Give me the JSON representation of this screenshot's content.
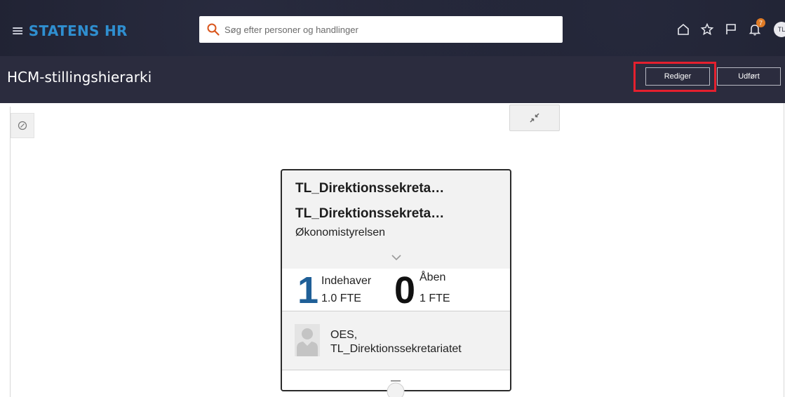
{
  "header": {
    "menu_icon": "hamburger-icon",
    "brand": "STATENS HR",
    "brand_color": "#2f8fd0",
    "search": {
      "placeholder": "Søg efter personer og handlinger",
      "value": ""
    },
    "icons": [
      "home-icon",
      "star-icon",
      "flag-icon",
      "bell-icon"
    ],
    "notification_count": "7",
    "user_initials": "TL"
  },
  "titlebar": {
    "title": "HCM-stillingshierarki",
    "edit_label": "Rediger",
    "done_label": "Udført",
    "highlight_color": "#e5202e"
  },
  "toolbar": {
    "side_tool_icon": "compass-icon",
    "collapse_icon": "collapse-arrows-icon"
  },
  "card": {
    "title": "TL_Direktionssekreta…",
    "subtitle": "TL_Direktionssekreta…",
    "organization": "Økonomistyrelsen",
    "incumbents_count": "1",
    "incumbents_label": "Indehaver",
    "incumbents_fte": "1.0 FTE",
    "open_count": "0",
    "open_label": "Åben",
    "open_fte": "1 FTE",
    "incumbent_name_line1": "OES,",
    "incumbent_name_line2": "TL_Direktionssekretariatet",
    "accent_color": "#1f5f97"
  }
}
